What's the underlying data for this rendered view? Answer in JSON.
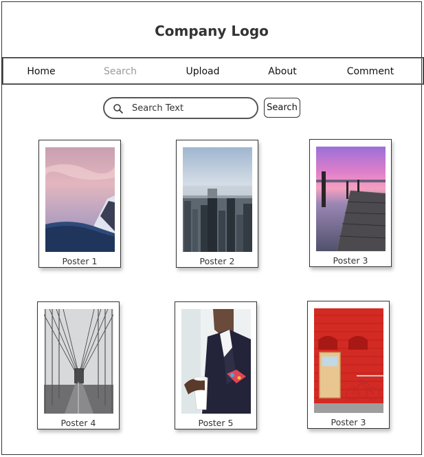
{
  "header": {
    "logo_text": "Company Logo"
  },
  "nav": {
    "items": [
      {
        "label": "Home",
        "active": true
      },
      {
        "label": "Search",
        "active": false
      },
      {
        "label": "Upload",
        "active": true
      },
      {
        "label": "About",
        "active": true
      },
      {
        "label": "Comment",
        "active": true
      }
    ]
  },
  "search": {
    "placeholder": "Search Text",
    "button_label": "Search",
    "icon": "search-icon"
  },
  "posters": [
    {
      "label": "Poster 1",
      "image": "snowy-mountain-pink-sky"
    },
    {
      "label": "Poster 2",
      "image": "city-skyline"
    },
    {
      "label": "Poster 3",
      "image": "wooden-pier-sunset"
    },
    {
      "label": "Poster 4",
      "image": "suspension-bridge"
    },
    {
      "label": "Poster 5",
      "image": "man-holding-coffee-cup"
    },
    {
      "label": "Poster 3",
      "image": "red-brick-wall-bicycle"
    }
  ],
  "colors": {
    "border": "#333333",
    "muted_nav": "#9a9a9a"
  }
}
